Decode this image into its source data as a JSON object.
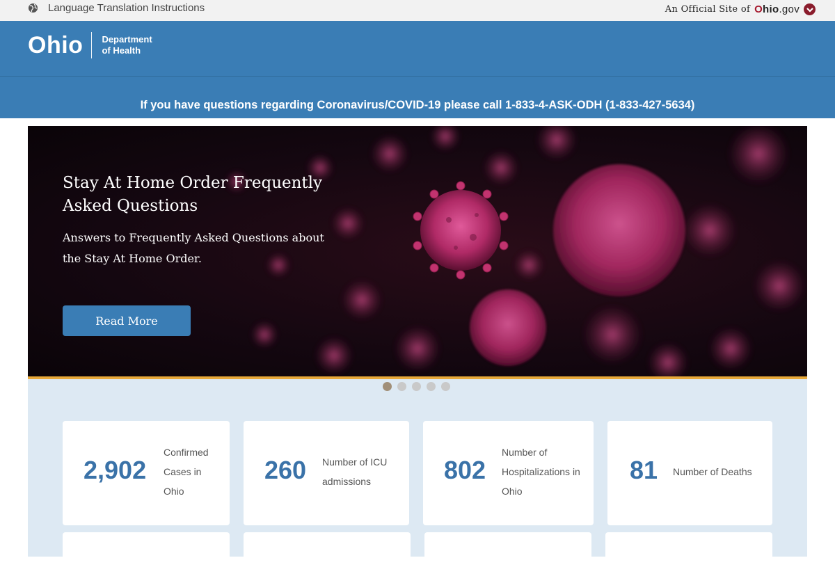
{
  "utility": {
    "language_link": "Language Translation Instructions",
    "official_prefix": "An Official Site of",
    "ohio_gov_o": "O",
    "ohio_gov_hio": "hio",
    "ohio_gov_suffix": ".gov"
  },
  "header": {
    "logo_text": "Ohio",
    "dept_line1": "Department",
    "dept_line2": "of Health"
  },
  "hotline": "If you have questions regarding Coronavirus/COVID-19 please call 1-833-4-ASK-ODH (1-833-427-5634)",
  "hero": {
    "title": "Stay At Home Order Frequently Asked Questions",
    "subtitle": "Answers to Frequently Asked Questions about the Stay At Home Order.",
    "button_label": "Read More",
    "slides_count": 5,
    "active_slide": 1
  },
  "stats": [
    {
      "number": "2,902",
      "label": "Confirmed Cases in Ohio"
    },
    {
      "number": "260",
      "label": "Number of ICU admissions"
    },
    {
      "number": "802",
      "label": "Number of Hospitalizations in Ohio"
    },
    {
      "number": "81",
      "label": "Number of Deaths"
    }
  ],
  "colors": {
    "brand_blue": "#3a7db5",
    "ohio_red": "#a6192e",
    "accent_gold": "#e8a93a",
    "stats_bg": "#dde9f3",
    "stat_number": "#3a72a8"
  }
}
